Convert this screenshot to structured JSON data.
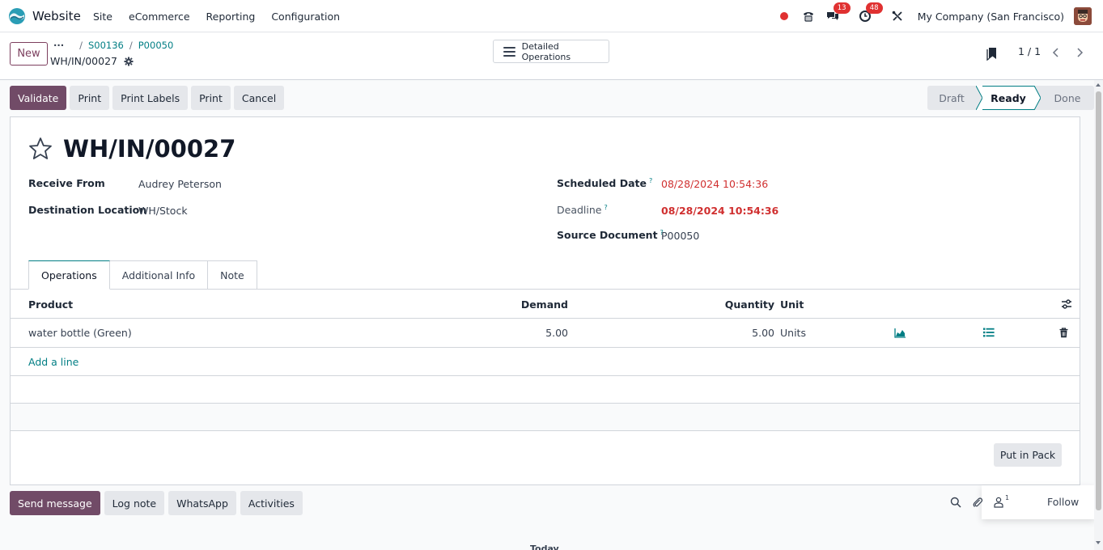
{
  "navbar": {
    "app_name": "Website",
    "menu": [
      "Site",
      "eCommerce",
      "Reporting",
      "Configuration"
    ],
    "messages_badge": "13",
    "activities_badge": "48",
    "company": "My Company (San Francisco)",
    "brand_color": "#714b67",
    "link_color": "#017e84"
  },
  "control": {
    "new_label": "New",
    "breadcrumb": [
      "S00136",
      "P00050"
    ],
    "record_name": "WH/IN/00027",
    "detailed_operations_label": "Detailed Operations",
    "pager": "1 / 1"
  },
  "actions": [
    "Validate",
    "Print",
    "Print Labels",
    "Print",
    "Cancel"
  ],
  "stages": [
    "Draft",
    "Ready",
    "Done"
  ],
  "active_stage": "Ready",
  "form": {
    "title": "WH/IN/00027",
    "receive_from_label": "Receive From",
    "receive_from": "Audrey Peterson",
    "destination_label": "Destination Location",
    "destination": "WH/Stock",
    "scheduled_label": "Scheduled Date",
    "scheduled": "08/28/2024 10:54:36",
    "deadline_label": "Deadline",
    "deadline": "08/28/2024 10:54:36",
    "source_label": "Source Document",
    "source": "P00050",
    "help_mark": "?"
  },
  "tabs": [
    "Operations",
    "Additional Info",
    "Note"
  ],
  "table": {
    "columns": [
      "Product",
      "Demand",
      "Quantity",
      "Unit"
    ],
    "rows": [
      {
        "product": "water bottle (Green)",
        "demand": "5.00",
        "quantity": "5.00",
        "unit": "Units"
      }
    ],
    "add_line": "Add a line",
    "put_in_pack": "Put in Pack"
  },
  "chatter": {
    "buttons": [
      "Send message",
      "Log note",
      "WhatsApp",
      "Activities"
    ],
    "followers_count": "1",
    "follow_label": "Follow",
    "date_separator": "Today"
  }
}
